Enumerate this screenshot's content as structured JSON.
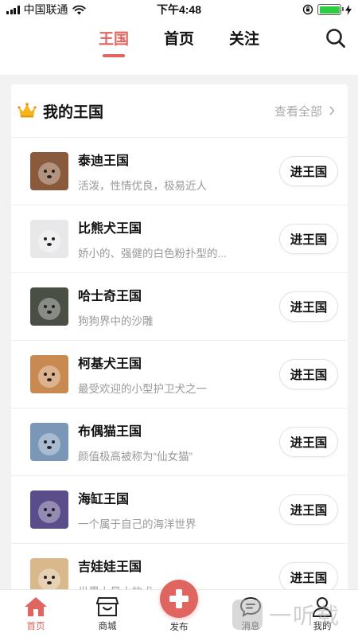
{
  "status_bar": {
    "carrier": "中国联通",
    "time": "下午4:48"
  },
  "top_nav": {
    "tabs": [
      {
        "label": "王国",
        "active": true
      },
      {
        "label": "首页",
        "active": false
      },
      {
        "label": "关注",
        "active": false
      }
    ],
    "search_icon": "search-icon"
  },
  "section": {
    "title": "我的王国",
    "view_all": "查看全部",
    "icon": "crown-icon"
  },
  "kingdoms": [
    {
      "name": "泰迪王国",
      "desc": "活泼，性情优良，极易近人",
      "button": "进王国",
      "thumb_color": "#8a5a3c"
    },
    {
      "name": "比熊犬王国",
      "desc": "娇小的、强健的白色粉扑型的...",
      "button": "进王国",
      "thumb_color": "#e8e8ea"
    },
    {
      "name": "哈士奇王国",
      "desc": "狗狗界中的沙雕",
      "button": "进王国",
      "thumb_color": "#4a4f46"
    },
    {
      "name": "柯基犬王国",
      "desc": "最受欢迎的小型护卫犬之一",
      "button": "进王国",
      "thumb_color": "#c98a52"
    },
    {
      "name": "布偶猫王国",
      "desc": "颜值极高被称为“仙女猫”",
      "button": "进王国",
      "thumb_color": "#7a97b8"
    },
    {
      "name": "海缸王国",
      "desc": "一个属于自己的海洋世界",
      "button": "进王国",
      "thumb_color": "#5b4d8a"
    },
    {
      "name": "吉娃娃王国",
      "desc": "世界上最小的犬",
      "button": "进王国",
      "thumb_color": "#d9b98c"
    }
  ],
  "tab_bar": {
    "home": "首页",
    "shop": "商城",
    "publish": "发布",
    "messages": "消息",
    "mine": "我的"
  },
  "watermark": {
    "text": "一听载"
  },
  "colors": {
    "accent": "#e0645f",
    "muted_text": "#999999",
    "battery_green": "#2ecc40"
  }
}
